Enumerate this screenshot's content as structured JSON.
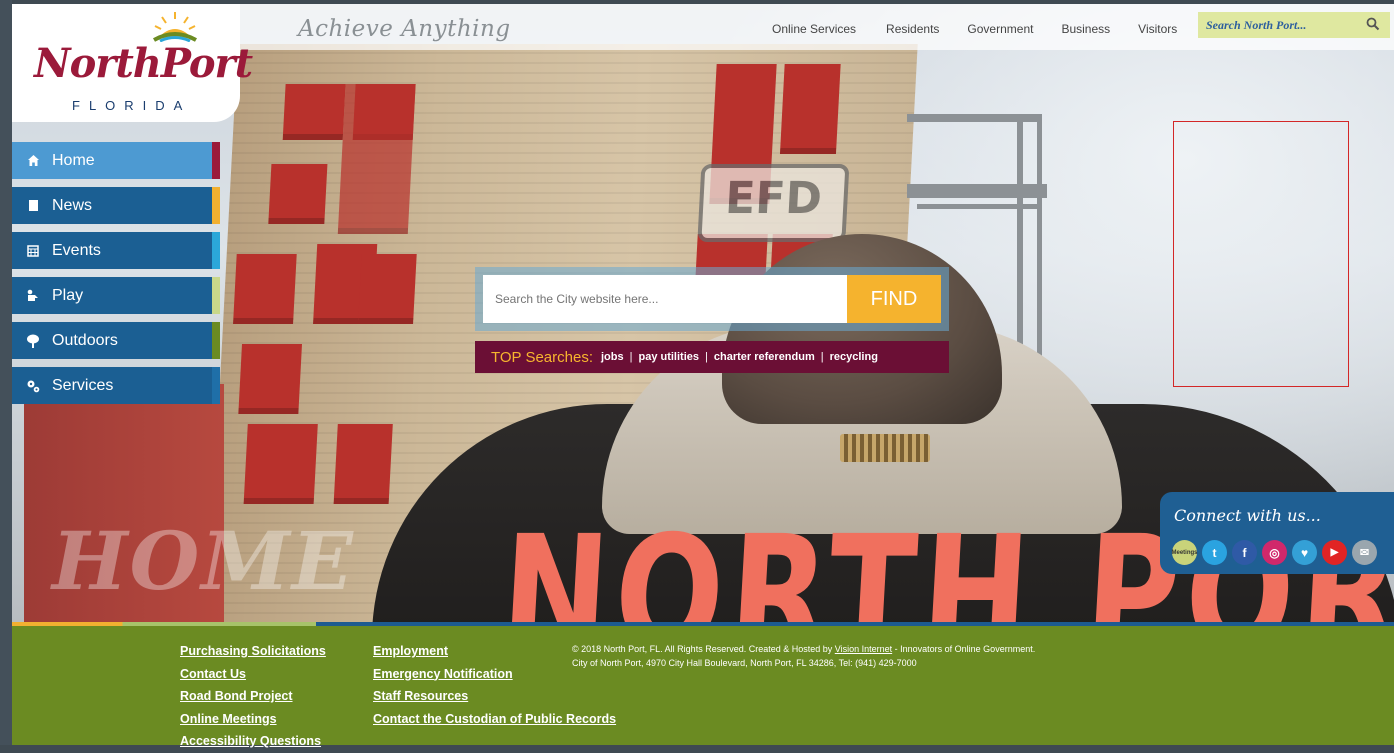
{
  "header": {
    "tagline": "Achieve Anything",
    "nav": [
      "Online Services",
      "Residents",
      "Government",
      "Business",
      "Visitors"
    ],
    "search_placeholder": "Search North Port..."
  },
  "logo": {
    "name": "NorthPort",
    "sub": "FLORIDA"
  },
  "sidebar": {
    "items": [
      {
        "label": "Home",
        "icon": "home-icon",
        "accent": "#9b1a3a"
      },
      {
        "label": "News",
        "icon": "document-icon",
        "accent": "#f2b030"
      },
      {
        "label": "Events",
        "icon": "calendar-icon",
        "accent": "#2ba7d9"
      },
      {
        "label": "Play",
        "icon": "play-icon",
        "accent": "#c9d88a"
      },
      {
        "label": "Outdoors",
        "icon": "tree-icon",
        "accent": "#6b8b22"
      },
      {
        "label": "Services",
        "icon": "gears-icon",
        "accent": "#1f6fa8"
      }
    ]
  },
  "hero": {
    "watermark": "HOME",
    "search": {
      "placeholder": "Search the City website here...",
      "button": "FIND"
    },
    "top_searches": {
      "heading": "TOP Searches:",
      "links": [
        "jobs",
        "pay utilities",
        "charter referendum",
        "recycling"
      ]
    }
  },
  "connect": {
    "title": "Connect with us...",
    "icons": [
      {
        "name": "meetings-icon",
        "label": "Meetings",
        "color": "#c9d37a"
      },
      {
        "name": "twitter-icon",
        "label": "t",
        "color": "#2aa3e0"
      },
      {
        "name": "facebook-icon",
        "label": "f",
        "color": "#2f5aa6"
      },
      {
        "name": "instagram-icon",
        "label": "◎",
        "color": "#d1286b"
      },
      {
        "name": "nextdoor-icon",
        "label": "♥",
        "color": "#34a0d6"
      },
      {
        "name": "youtube-icon",
        "label": "▶",
        "color": "#e12424"
      },
      {
        "name": "email-icon",
        "label": "✉",
        "color": "#9aa6ae"
      }
    ]
  },
  "footer": {
    "col1": [
      "Purchasing Solicitations",
      "Contact Us",
      "Road Bond Project",
      "Online Meetings",
      "Accessibility Questions"
    ],
    "col2": [
      "Employment",
      "Emergency Notification",
      "Staff Resources",
      "Contact the Custodian of Public Records"
    ],
    "copyright_pre": "© 2018 North Port, FL. All Rights Reserved. Created & Hosted by ",
    "copyright_link": "Vision Internet",
    "copyright_post": " - Innovators of Online Government.",
    "address": "City of North Port, 4970 City Hall Boulevard, North Port, FL 34286, Tel: (941) 429-7000"
  }
}
